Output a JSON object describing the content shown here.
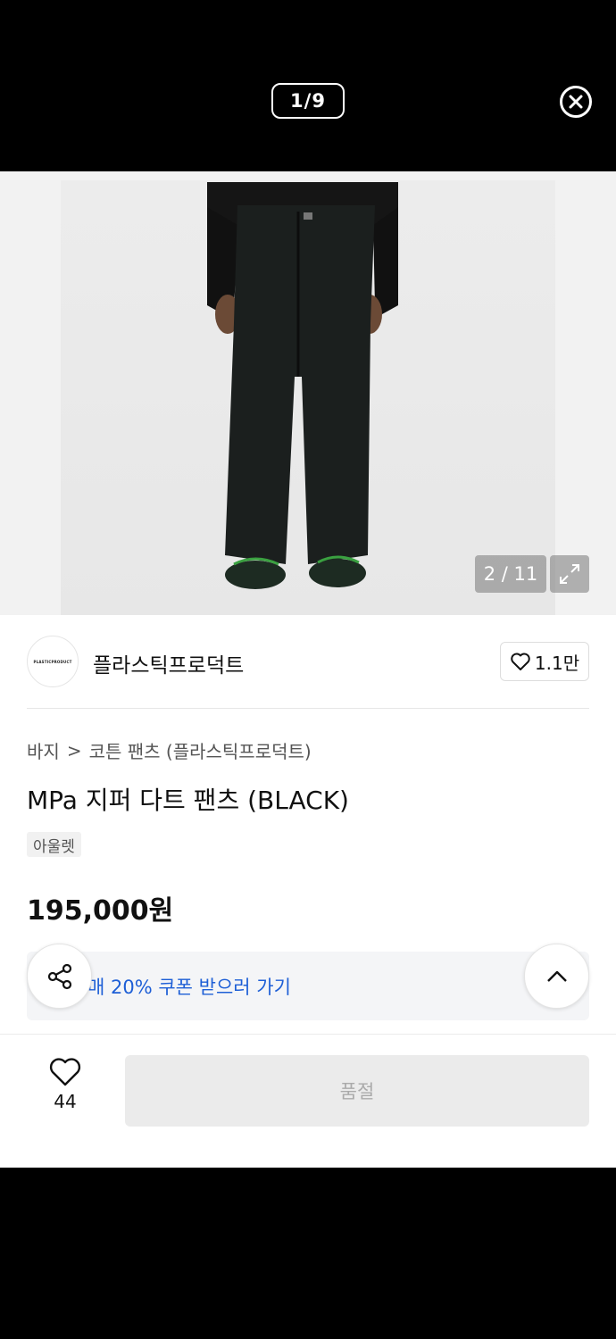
{
  "viewer": {
    "counter": "1/9"
  },
  "gallery": {
    "image_counter": "2 / 11"
  },
  "brand": {
    "logo_text": "PLASTICPRODUCT",
    "name": "플라스틱프로덕트",
    "likes": "1.1만"
  },
  "breadcrumb": {
    "category": "바지",
    "separator": ">",
    "subcategory": "코튼 팬츠 (플라스틱프로덕트)"
  },
  "product": {
    "title": "MPa 지퍼 다트 팬츠 (BLACK)",
    "badge": "아울렛",
    "price": "195,000원"
  },
  "coupon": {
    "text": "매 20% 쿠폰 받으러 가기"
  },
  "bottom_bar": {
    "wish_count": "44",
    "soldout_label": "품절"
  },
  "icons": {
    "close": "close-icon",
    "expand": "expand-icon",
    "heart": "heart-icon",
    "share": "share-icon",
    "up": "chevron-up-icon"
  },
  "colors": {
    "coupon_text": "#1e5fd6",
    "soldout_bg": "#ebebeb"
  }
}
